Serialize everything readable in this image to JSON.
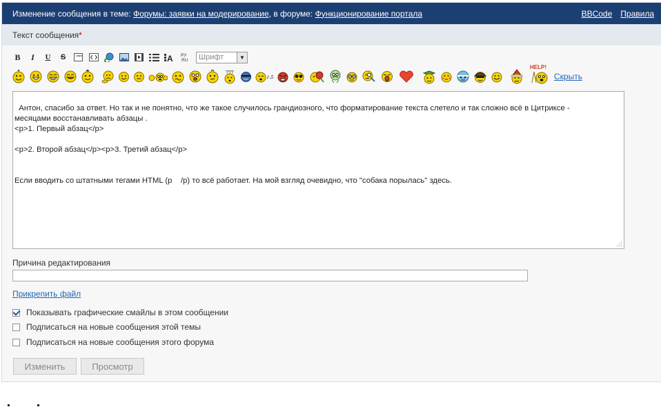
{
  "header": {
    "prefix": "Изменение сообщения в теме: ",
    "topic_link": "Форумы: заявки на модерирование",
    "middle": ", в форуме: ",
    "forum_link": "Функционирование портала",
    "bbcode_link": "BBCode",
    "rules_link": "Правила"
  },
  "section": {
    "title": "Текст сообщения",
    "required_mark": "*"
  },
  "toolbar": {
    "bold": "B",
    "italic": "I",
    "underline": "U",
    "strike": "S",
    "font_select": "Шрифт",
    "buttons": [
      "bold-icon",
      "italic-icon",
      "underline-icon",
      "strike-icon",
      "quote-icon",
      "code-icon",
      "link-icon",
      "image-icon",
      "video-icon",
      "list-icon",
      "font-color-icon",
      "translit-icon"
    ]
  },
  "smiles": {
    "hide_link": "Скрыть",
    "help_label": "HELP!",
    "colors": {
      "face": "#f5d400",
      "outline": "#8a6d00",
      "heart": "#e8452c",
      "blue": "#3f6fb0",
      "green": "#46a046",
      "red": "#d23a2a"
    }
  },
  "message": {
    "text": "Антон, спасибо за ответ. Но так и не понятно, что же такое случилось грандиозного, что форматирование текста слетело и так сложно всё в Цитриксе -\nмесяцами восстанавливать абзацы .\n<p>1. Первый абзац</p>\n\n<p>2. Второй абзац</p><p>3. Третий абзац</p>\n\n\nЕсли вводить со штатными тегами HTML (p    /p) то всё работает. На мой взгляд очевидно, что \"собака порылась\" здесь."
  },
  "edit_reason": {
    "label": "Причина редактирования",
    "value": ""
  },
  "attach_link": "Прикрепить файл",
  "options": [
    {
      "label": "Показывать графические смайлы в этом сообщении",
      "checked": true
    },
    {
      "label": "Подписаться на новые сообщения этой темы",
      "checked": false
    },
    {
      "label": "Подписаться на новые сообщения этого форума",
      "checked": false
    }
  ],
  "buttons": {
    "submit": "Изменить",
    "preview": "Просмотр"
  },
  "colors": {
    "header_bg": "#1c3f73",
    "section_bg": "#e4e9ef",
    "link": "#2066b5",
    "required": "#cc0000"
  }
}
